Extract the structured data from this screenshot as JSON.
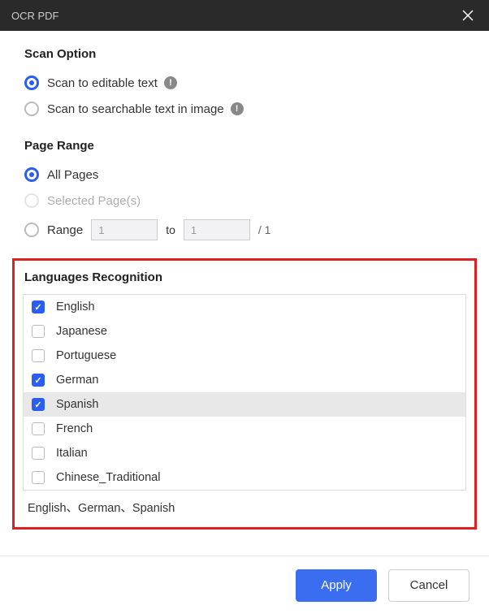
{
  "titlebar": {
    "title": "OCR PDF"
  },
  "scan": {
    "heading": "Scan Option",
    "opt_editable": "Scan to editable text",
    "opt_searchable": "Scan to searchable text in image"
  },
  "pagerange": {
    "heading": "Page Range",
    "opt_all": "All Pages",
    "opt_selected": "Selected Page(s)",
    "opt_range": "Range",
    "from_value": "1",
    "to_label": "to",
    "to_value": "1",
    "total": "/ 1"
  },
  "languages": {
    "heading": "Languages Recognition",
    "items": [
      {
        "label": "English",
        "checked": true,
        "highlight": false
      },
      {
        "label": "Japanese",
        "checked": false,
        "highlight": false
      },
      {
        "label": "Portuguese",
        "checked": false,
        "highlight": false
      },
      {
        "label": "German",
        "checked": true,
        "highlight": false
      },
      {
        "label": "Spanish",
        "checked": true,
        "highlight": true
      },
      {
        "label": "French",
        "checked": false,
        "highlight": false
      },
      {
        "label": "Italian",
        "checked": false,
        "highlight": false
      },
      {
        "label": "Chinese_Traditional",
        "checked": false,
        "highlight": false
      }
    ],
    "summary": "English、German、Spanish"
  },
  "footer": {
    "apply": "Apply",
    "cancel": "Cancel"
  }
}
